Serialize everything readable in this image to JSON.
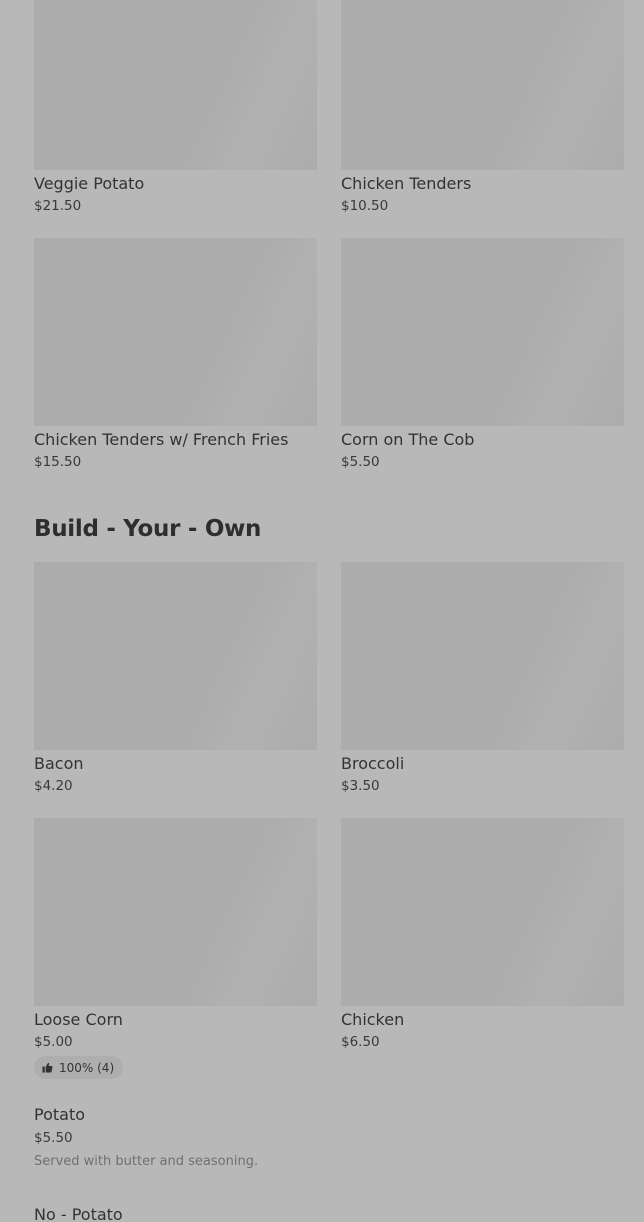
{
  "menu": {
    "top_items": [
      {
        "name": "Veggie Potato",
        "price": "$21.50"
      },
      {
        "name": "Chicken Tenders",
        "price": "$10.50"
      },
      {
        "name": "Chicken Tenders w/ French Fries",
        "price": "$15.50"
      },
      {
        "name": "Corn on The Cob",
        "price": "$5.50"
      }
    ],
    "section": {
      "title": "Build - Your - Own",
      "items": [
        {
          "name": "Bacon",
          "price": "$4.20"
        },
        {
          "name": "Broccoli",
          "price": "$3.50"
        },
        {
          "name": "Loose Corn",
          "price": "$5.00",
          "rating": "100% (4)"
        },
        {
          "name": "Chicken",
          "price": "$6.50"
        }
      ]
    },
    "list_items": [
      {
        "name": "Potato",
        "price": "$5.50",
        "description": "Served with butter and seasoning."
      },
      {
        "name": "No - Potato"
      }
    ]
  },
  "icons": {
    "rating": "thumbs-up-icon"
  },
  "colors": {
    "background": "#b8b8b8",
    "image_placeholder": "#acacac",
    "text": "#333333",
    "muted_text": "#707070"
  }
}
